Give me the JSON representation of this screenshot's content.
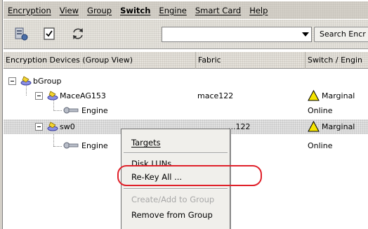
{
  "menubar": {
    "items": [
      {
        "label": "Encryption"
      },
      {
        "label": "View"
      },
      {
        "label": "Group"
      },
      {
        "label": "Switch"
      },
      {
        "label": "Engine"
      },
      {
        "label": "Smart Card"
      },
      {
        "label": "Help"
      }
    ]
  },
  "toolbar": {
    "icons": [
      "add-device-icon",
      "checklist-icon",
      "refresh-icon"
    ],
    "search_value": "",
    "search_button_label": "Search Encr"
  },
  "table": {
    "columns": [
      "Encryption Devices (Group View)",
      "Fabric",
      "Switch / Engin"
    ],
    "rows": [
      {
        "name": "bGroup",
        "fabric": "",
        "status": ""
      },
      {
        "name": "MaceAG153",
        "fabric": "mace122",
        "status": "Marginal"
      },
      {
        "name": "Engine",
        "fabric": "",
        "status": "Online"
      },
      {
        "name": "sw0",
        "fabric": "...122",
        "status": "Marginal"
      },
      {
        "name": "Engine",
        "fabric": "",
        "status": "Online"
      }
    ]
  },
  "context_menu": {
    "items": [
      {
        "label": "Targets",
        "enabled": true
      },
      {
        "label": "Disk LUNs",
        "enabled": true
      },
      {
        "label": "Re-Key All ...",
        "enabled": true,
        "highlighted": true
      },
      {
        "label": "Create/Add to Group",
        "enabled": false
      },
      {
        "label": "Remove from Group",
        "enabled": true
      }
    ]
  },
  "colors": {
    "highlight_ring": "#e0212a",
    "warning_fill": "#f5e400",
    "window_chrome": "#d4d0c8"
  }
}
